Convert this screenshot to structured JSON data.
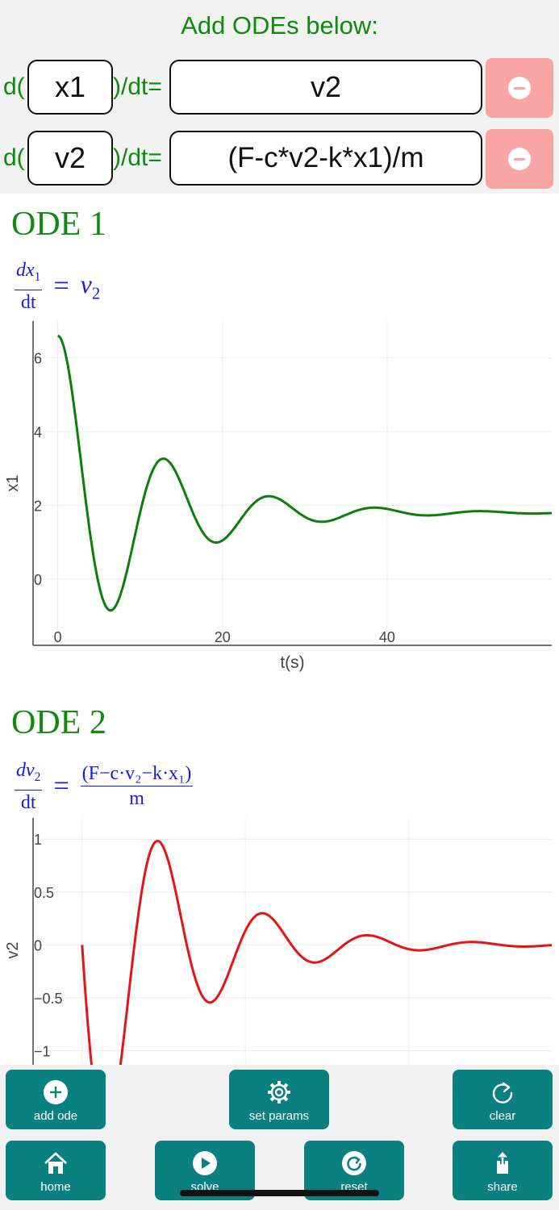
{
  "editor": {
    "title": "Add ODEs below:",
    "d_prefix": "d(",
    "dt_suffix": ")/dt=",
    "odes": [
      {
        "variable": "x1",
        "expression": "v2"
      },
      {
        "variable": "v2",
        "expression": "(F-c*v2-k*x1)/m"
      }
    ]
  },
  "ode1": {
    "heading": "ODE 1",
    "equation": {
      "num_d": "dx",
      "num_sub": "1",
      "den": "dt",
      "eq": "=",
      "rhs_var": "v",
      "rhs_sub": "2"
    }
  },
  "ode2": {
    "heading": "ODE 2",
    "equation": {
      "num_d": "dv",
      "num_sub": "2",
      "den": "dt",
      "eq": "=",
      "rhs_num": "(F−c·v₂−k·x₁)",
      "rhs_den": "m"
    }
  },
  "chart_data": [
    {
      "type": "line",
      "title": "",
      "xlabel": "t(s)",
      "ylabel": "x1",
      "xlim": [
        -3,
        60
      ],
      "ylim": [
        -1.8,
        7
      ],
      "xticks": [
        0,
        20,
        40
      ],
      "yticks": [
        0,
        2,
        4,
        6
      ],
      "grid": true,
      "color": "#0a7f0a",
      "model": {
        "equilibrium": 1.8,
        "amplitude": 4.8,
        "decay": 0.0925,
        "omega": 0.49
      }
    },
    {
      "type": "line",
      "title": "",
      "xlabel": "",
      "ylabel": "v2",
      "xlim": [
        -6,
        57.5
      ],
      "ylim": [
        -1.3,
        1.2
      ],
      "yticks": [
        -1,
        -0.5,
        0,
        0.5,
        1
      ],
      "ytick_labels": [
        "−1",
        "−0.5",
        "0",
        "0.5",
        "1"
      ],
      "grid": true,
      "color": "#e61414",
      "model": {
        "amplitude": 2.35,
        "decay": 0.0925,
        "omega": 0.49
      }
    }
  ],
  "toolbar": {
    "add_ode": "add ode",
    "set_params": "set params",
    "clear": "clear",
    "home": "home",
    "solve": "solve",
    "reset": "reset",
    "share": "share"
  },
  "colors": {
    "accent": "#0a8080",
    "green": "#0f8a0f",
    "remove": "#f9a5a5",
    "math_blue": "#1a1adf"
  }
}
